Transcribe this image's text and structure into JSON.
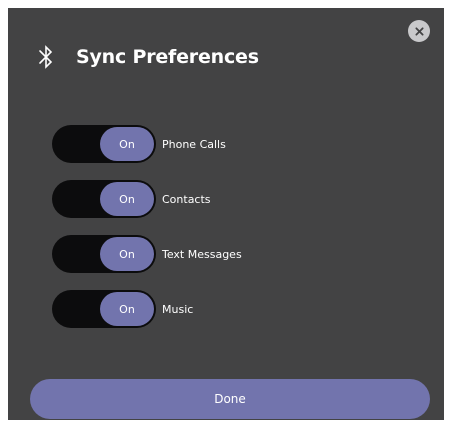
{
  "dialog": {
    "title": "Sync Preferences",
    "title_icon": "bluetooth-icon",
    "close_icon": "close-icon"
  },
  "preferences": [
    {
      "label": "Phone Calls",
      "state": "On",
      "enabled": true
    },
    {
      "label": "Contacts",
      "state": "On",
      "enabled": true
    },
    {
      "label": "Text Messages",
      "state": "On",
      "enabled": true
    },
    {
      "label": "Music",
      "state": "On",
      "enabled": true
    }
  ],
  "footer": {
    "done_label": "Done"
  },
  "colors": {
    "dialog_background": "#434344",
    "accent": "#7274ad",
    "toggle_track": "#0c0c0d",
    "close_button": "#c9c9cb"
  }
}
